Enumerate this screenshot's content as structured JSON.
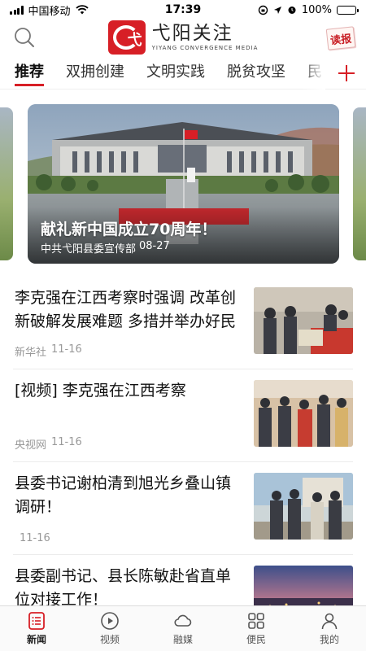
{
  "status_bar": {
    "carrier": "中国移动",
    "time": "17:39",
    "battery_percent": "100%",
    "battery_level": 1.0
  },
  "header": {
    "logo_title": "弋阳关注",
    "logo_subtitle": "YIYANG CONVERGENCE MEDIA",
    "logo_mark_char": "弋",
    "reader_label": "读报",
    "icons": {
      "search": "search-icon",
      "reader": "newspaper-icon"
    }
  },
  "tabs": {
    "items": [
      "推荐",
      "双拥创建",
      "文明实践",
      "脱贫攻坚",
      "民"
    ],
    "active_index": 0,
    "add_icon": "plus-icon"
  },
  "carousel": {
    "title": "献礼新中国成立70周年！",
    "source": "中共弋阳县委宣传部",
    "date": "08-27"
  },
  "news": [
    {
      "title": "李克强在江西考察时强调 改革创新破解发展难题 多措并举办好民",
      "source": "新华社",
      "date": "11-16"
    },
    {
      "title": "[视频] 李克强在江西考察",
      "source": "央视网",
      "date": "11-16"
    },
    {
      "title": "县委书记谢柏清到旭光乡叠山镇调研！",
      "source": "",
      "date": "11-16"
    },
    {
      "title": "县委副书记、县长陈敏赴省直单位对接工作！",
      "source": "",
      "date": ""
    }
  ],
  "bottom_nav": {
    "items": [
      {
        "label": "新闻",
        "icon": "news-list-icon"
      },
      {
        "label": "视频",
        "icon": "play-circle-icon"
      },
      {
        "label": "融媒",
        "icon": "cloud-icon"
      },
      {
        "label": "便民",
        "icon": "grid-icon"
      },
      {
        "label": "我的",
        "icon": "person-icon"
      }
    ],
    "active_index": 0
  },
  "colors": {
    "brand_red": "#d71f26",
    "text_primary": "#111111",
    "text_meta": "#999999"
  }
}
